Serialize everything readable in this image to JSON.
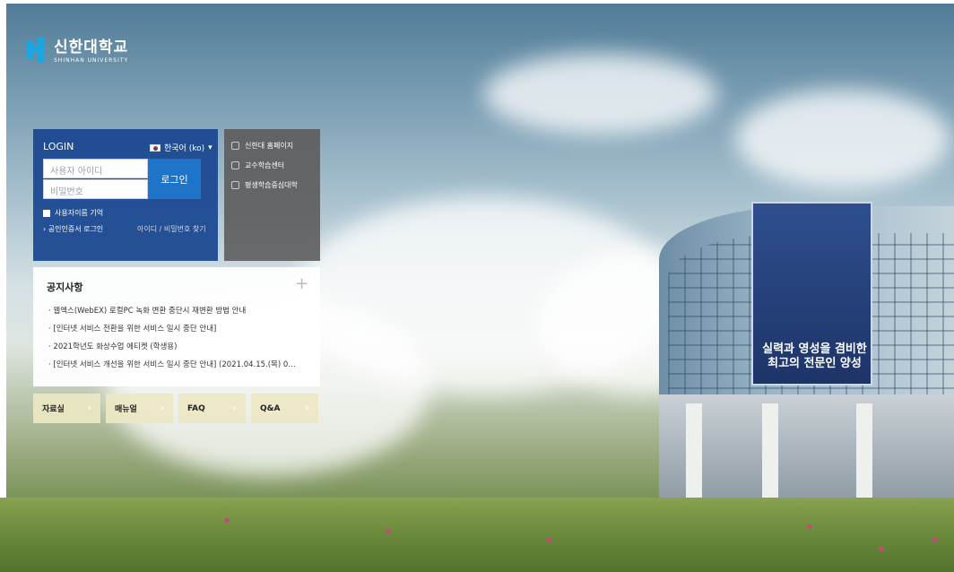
{
  "brand": {
    "name": "신한대학교",
    "subtitle": "SHINHAN UNIVERSITY"
  },
  "login": {
    "title": "LOGIN",
    "language": "한국어 (ko)",
    "username_placeholder": "사용자 아이디",
    "password_placeholder": "비밀번호",
    "login_button": "로그인",
    "remember_label": "사용자이름 기억",
    "cert_login": "공인인증서 로그인",
    "find_account": "아이디 / 비밀번호 찾기"
  },
  "quick_links": [
    {
      "label": "신한대 홈페이지",
      "icon": "cube-icon"
    },
    {
      "label": "교수학습센터",
      "icon": "cube-icon"
    },
    {
      "label": "평생학습중심대학",
      "icon": "cube-icon"
    }
  ],
  "notice": {
    "title": "공지사항",
    "more": "+",
    "items": [
      "웹엑스(WebEX) 로컬PC 녹화 변환 중단시 재변환 방법 안내",
      "[인터넷 서비스 전환을 위한 서비스 일시 중단 안내]",
      "2021학년도 화상수업 에티켓 (학생용)",
      "[인터넷 서비스 개선을 위한 서비스 일시 중단 안내] (2021.04.15.(목) 0…"
    ]
  },
  "bottom_buttons": [
    {
      "label": "자료실"
    },
    {
      "label": "매뉴얼"
    },
    {
      "label": "FAQ"
    },
    {
      "label": "Q&A"
    }
  ],
  "building_banner": "실력과 영성을 겸비한 최고의 전문인 양성"
}
